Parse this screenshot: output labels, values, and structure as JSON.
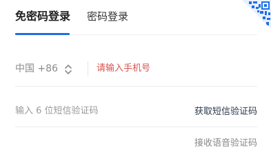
{
  "tabs": {
    "active": "免密码登录",
    "inactive": "密码登录"
  },
  "qr_corner": {
    "icon": "qr-code-icon",
    "color": "#1e6fe3"
  },
  "phone": {
    "country_code": "中国 +86",
    "placeholder": "请输入手机号"
  },
  "sms": {
    "placeholder": "输入 6 位短信验证码",
    "get_code_label": "获取短信验证码"
  },
  "voice": {
    "label": "接收语音验证码"
  },
  "colors": {
    "accent": "#1e6fe3",
    "error": "#d9534f"
  }
}
